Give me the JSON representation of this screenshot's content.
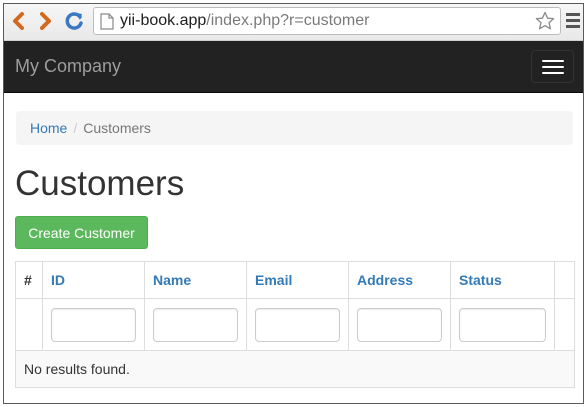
{
  "browser": {
    "url_host": "yii-book.app",
    "url_path": "/index.php?r=customer"
  },
  "navbar": {
    "brand": "My Company"
  },
  "breadcrumb": {
    "home": "Home",
    "separator": "/",
    "current": "Customers"
  },
  "page": {
    "title": "Customers",
    "create_button": "Create Customer"
  },
  "grid": {
    "columns": [
      "#",
      "ID",
      "Name",
      "Email",
      "Address",
      "Status"
    ],
    "filters": {
      "id": "",
      "name": "",
      "email": "",
      "address": "",
      "status": ""
    },
    "empty_text": "No results found."
  },
  "colors": {
    "navbar_bg": "#222222",
    "brand_text": "#9d9d9d",
    "link": "#337ab7",
    "success": "#5cb85c"
  },
  "icons": [
    "back-arrow-icon",
    "forward-arrow-icon",
    "reload-icon",
    "page-icon",
    "star-icon",
    "menu-icon",
    "hamburger-icon"
  ]
}
